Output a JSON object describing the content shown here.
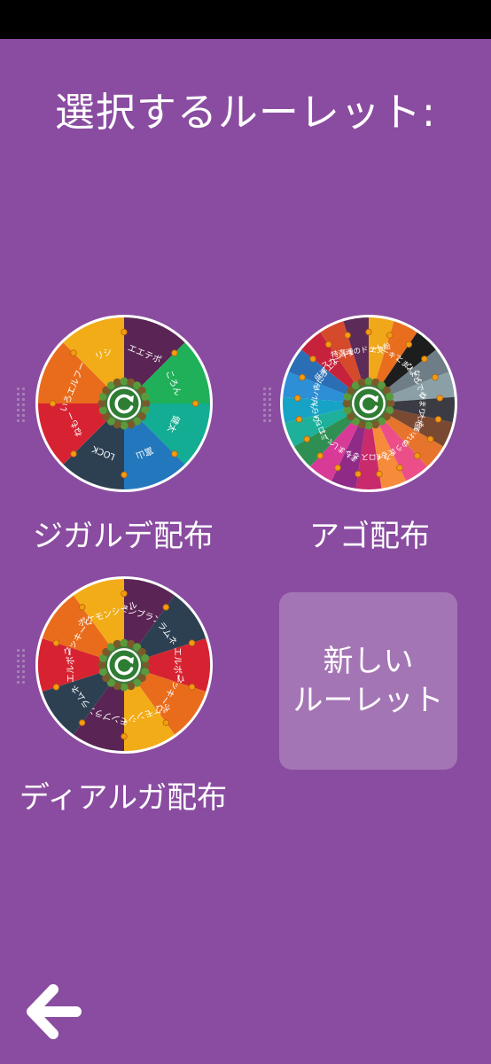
{
  "status_bar": {},
  "title": "選択するルーレット:",
  "wheels": [
    {
      "name": "ジガルデ配布",
      "segments": [
        {
          "label": "エエテポ",
          "color": "#5a2454"
        },
        {
          "label": "ころん",
          "color": "#21b05a"
        },
        {
          "label": "健太",
          "color": "#12ad93"
        },
        {
          "label": "富山",
          "color": "#2378bd"
        },
        {
          "label": "LOCK",
          "color": "#2d4052"
        },
        {
          "label": "ねもー",
          "color": "#d72331"
        },
        {
          "label": "いろエルフーン",
          "color": "#e96c1c"
        },
        {
          "label": "リシ",
          "color": "#f2ac17"
        }
      ]
    },
    {
      "name": "アゴ配布",
      "segments": [
        {
          "label": "エス",
          "color": "#f0a71a"
        },
        {
          "label": "パーキブル",
          "color": "#e86e1e"
        },
        {
          "label": "とまよ",
          "color": "#1d1d1d"
        },
        {
          "label": "ひよどり",
          "color": "#6f7e86"
        },
        {
          "label": "なんでやねん",
          "color": "#8aa0a6"
        },
        {
          "label": "ひまりり",
          "color": "#3b3b44"
        },
        {
          "label": "大地輝",
          "color": "#7a4931"
        },
        {
          "label": "れいれいれ",
          "color": "#e6742c"
        },
        {
          "label": "ゆうき",
          "color": "#ec4f87"
        },
        {
          "label": "えるも",
          "color": "#f58b3b"
        },
        {
          "label": "カイロスの里",
          "color": "#c82a6b"
        },
        {
          "label": "るう",
          "color": "#8f2a86"
        },
        {
          "label": "ましましまし",
          "color": "#d83a98"
        },
        {
          "label": "ベーお",
          "color": "#2f8f52"
        },
        {
          "label": "ミコちゃん",
          "color": "#1eb09a"
        },
        {
          "label": "ひらたけ",
          "color": "#17a3c5"
        },
        {
          "label": "ハルバード",
          "color": "#2d8fd6"
        },
        {
          "label": "おにぎり",
          "color": "#2a6fb6"
        },
        {
          "label": "低浮上よみあ",
          "color": "#c7223b"
        },
        {
          "label": "スカート好きの",
          "color": "#d64a2c"
        },
        {
          "label": "特選魂のドット絵",
          "color": "#5d2b58"
        }
      ]
    },
    {
      "name": "ディアルガ配布",
      "segments": [
        {
          "label": "モンブラン",
          "color": "#5a2454"
        },
        {
          "label": "ラムネ",
          "color": "#2d4052"
        },
        {
          "label": "エルボー",
          "color": "#d72331"
        },
        {
          "label": "クッキーくん",
          "color": "#e96c1c"
        },
        {
          "label": "ポケモンシール",
          "color": "#f2ac17"
        },
        {
          "label": "モンブラン",
          "color": "#5a2454"
        },
        {
          "label": "ラムネ",
          "color": "#2d4052"
        },
        {
          "label": "エルボー",
          "color": "#d72331"
        },
        {
          "label": "クッキーくん",
          "color": "#e96c1c"
        },
        {
          "label": "ポケモンシール",
          "color": "#f2ac17"
        }
      ]
    }
  ],
  "new_roulette": "新しい\nルーレット",
  "icons": {
    "back": "arrow-left-icon",
    "spin": "refresh-icon",
    "grip": "drag-handle-icon"
  },
  "colors": {
    "background": "#8a4ca0",
    "card": "#a475b4",
    "hub": "#2e7d32",
    "peg": "#f39c12"
  }
}
